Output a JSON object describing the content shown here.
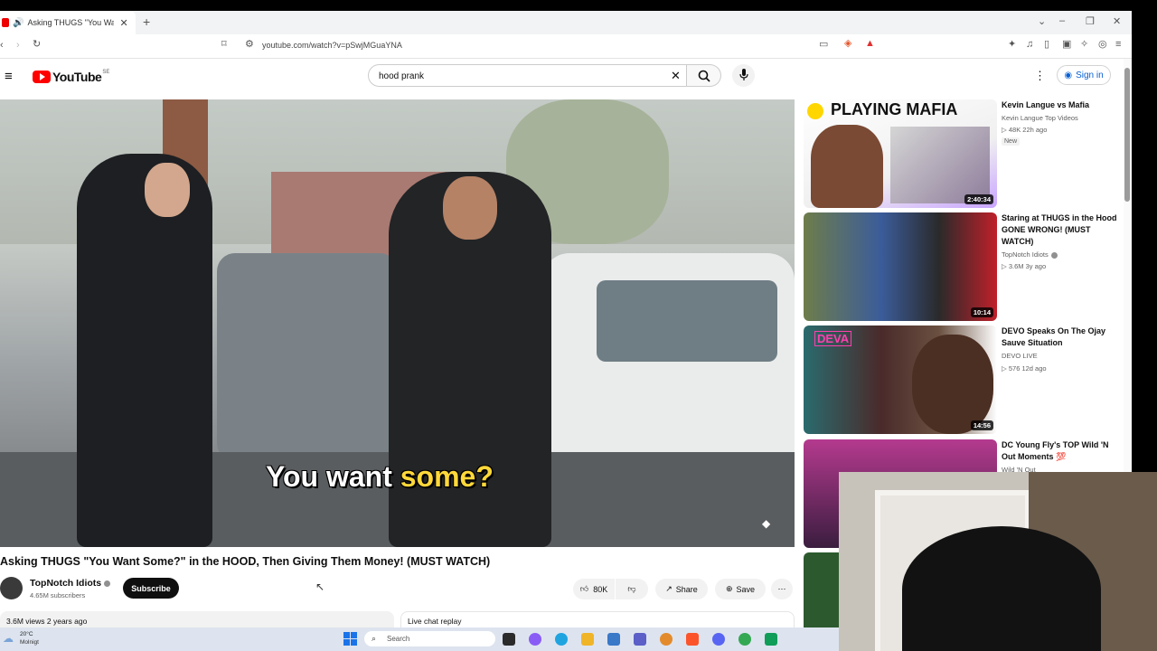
{
  "browser": {
    "tab_title": "Asking THUGS \"You Want So...",
    "tab_close": "✕",
    "new_tab": "+",
    "url": "youtube.com/watch?v=pSwjMGuaYNA",
    "window_controls": [
      "⌄",
      "–",
      "❐",
      "✕"
    ]
  },
  "header": {
    "logo_text": "YouTube",
    "country_code": "SE",
    "search_value": "hood prank",
    "search_placeholder": "Search",
    "sign_in": "Sign in"
  },
  "video": {
    "caption_part1": "You want ",
    "caption_part2": "some?",
    "title": "Asking THUGS \"You Want Some?\" in the HOOD, Then Giving Them Money! (MUST WATCH)",
    "channel": "TopNotch Idiots",
    "subscribers": "4.65M subscribers",
    "subscribe_label": "Subscribe",
    "likes": "80K",
    "share_label": "Share",
    "save_label": "Save",
    "views_date": "3.6M views  2 years ago",
    "live_chat": "Live chat replay"
  },
  "recommendations": [
    {
      "thumb_text": "PLAYING MAFIA",
      "duration": "2:40:34",
      "title": "Kevin Langue vs Mafia",
      "channel": "Kevin Langue Top Videos",
      "meta": "▷ 48K  22h ago",
      "badge": "New"
    },
    {
      "duration": "10:14",
      "title": "Staring at THUGS in the Hood GONE WRONG! (MUST WATCH)",
      "channel": "TopNotch Idiots",
      "meta": "▷ 3.6M  3y ago"
    },
    {
      "thumb_text": "DEVA",
      "duration": "14:56",
      "title": "DEVO Speaks On The Ojay Sauve Situation",
      "channel": "DEVO LIVE",
      "meta": "▷ 576  12d ago"
    },
    {
      "title": "DC Young Fly's TOP Wild 'N Out Moments 💯",
      "channel": "Wild 'N Out"
    }
  ],
  "taskbar": {
    "weather_temp": "20°C",
    "weather_desc": "Molnigt",
    "search_label": "Search"
  },
  "colors": {
    "youtube_red": "#ff0000",
    "link_blue": "#065fd4",
    "pill_bg": "#f2f2f2"
  }
}
